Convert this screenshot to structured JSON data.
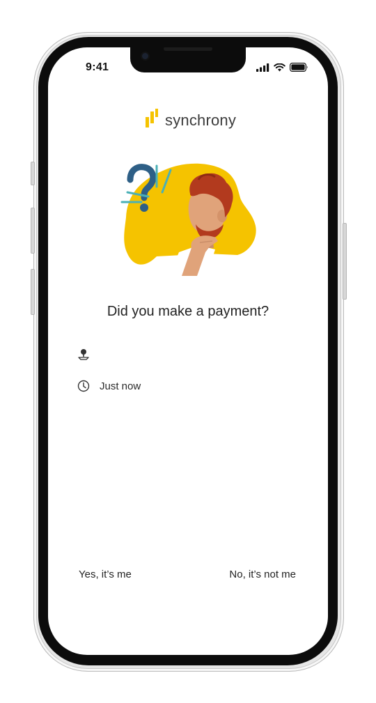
{
  "status_bar": {
    "time": "9:41",
    "icons": [
      "cellular-signal-icon",
      "wifi-icon",
      "battery-icon"
    ]
  },
  "brand": {
    "name": "synchrony",
    "colors": {
      "gold": "#F5C300",
      "text": "#3C3C3C"
    }
  },
  "illustration": {
    "subject": "person-thinking-with-question-mark",
    "colors": {
      "blob": "#F5C300",
      "skin": "#E0A37A",
      "hair": "#B23A1E",
      "question": "#2E5F86",
      "accent": "#4AB0B6"
    }
  },
  "prompt": {
    "question": "Did you make a payment?"
  },
  "details": {
    "location_icon": "location-pin-icon",
    "location_text": "",
    "time_icon": "clock-icon",
    "time_text": "Just now"
  },
  "actions": {
    "confirm_label": "Yes, it’s me",
    "deny_label": "No, it’s not me"
  }
}
